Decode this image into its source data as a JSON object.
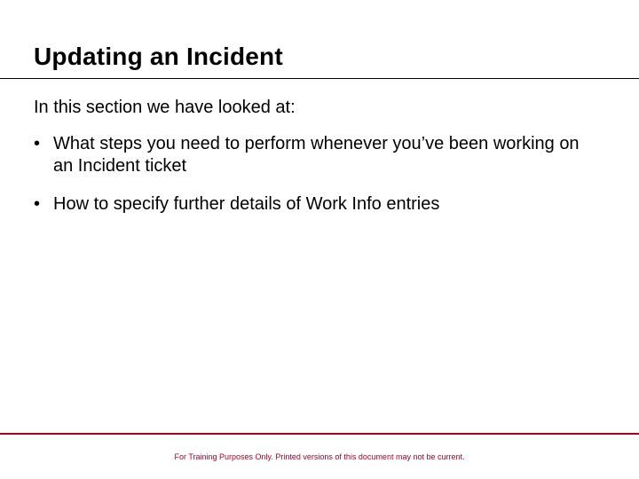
{
  "title": "Updating an Incident",
  "intro": "In this section we have looked at:",
  "bullets": [
    "What steps you need to perform whenever you’ve been working on an Incident ticket",
    "How to specify further details of Work Info entries"
  ],
  "footer": "For Training Purposes Only. Printed versions of this document may not be current.",
  "colors": {
    "accent": "#b00020"
  }
}
